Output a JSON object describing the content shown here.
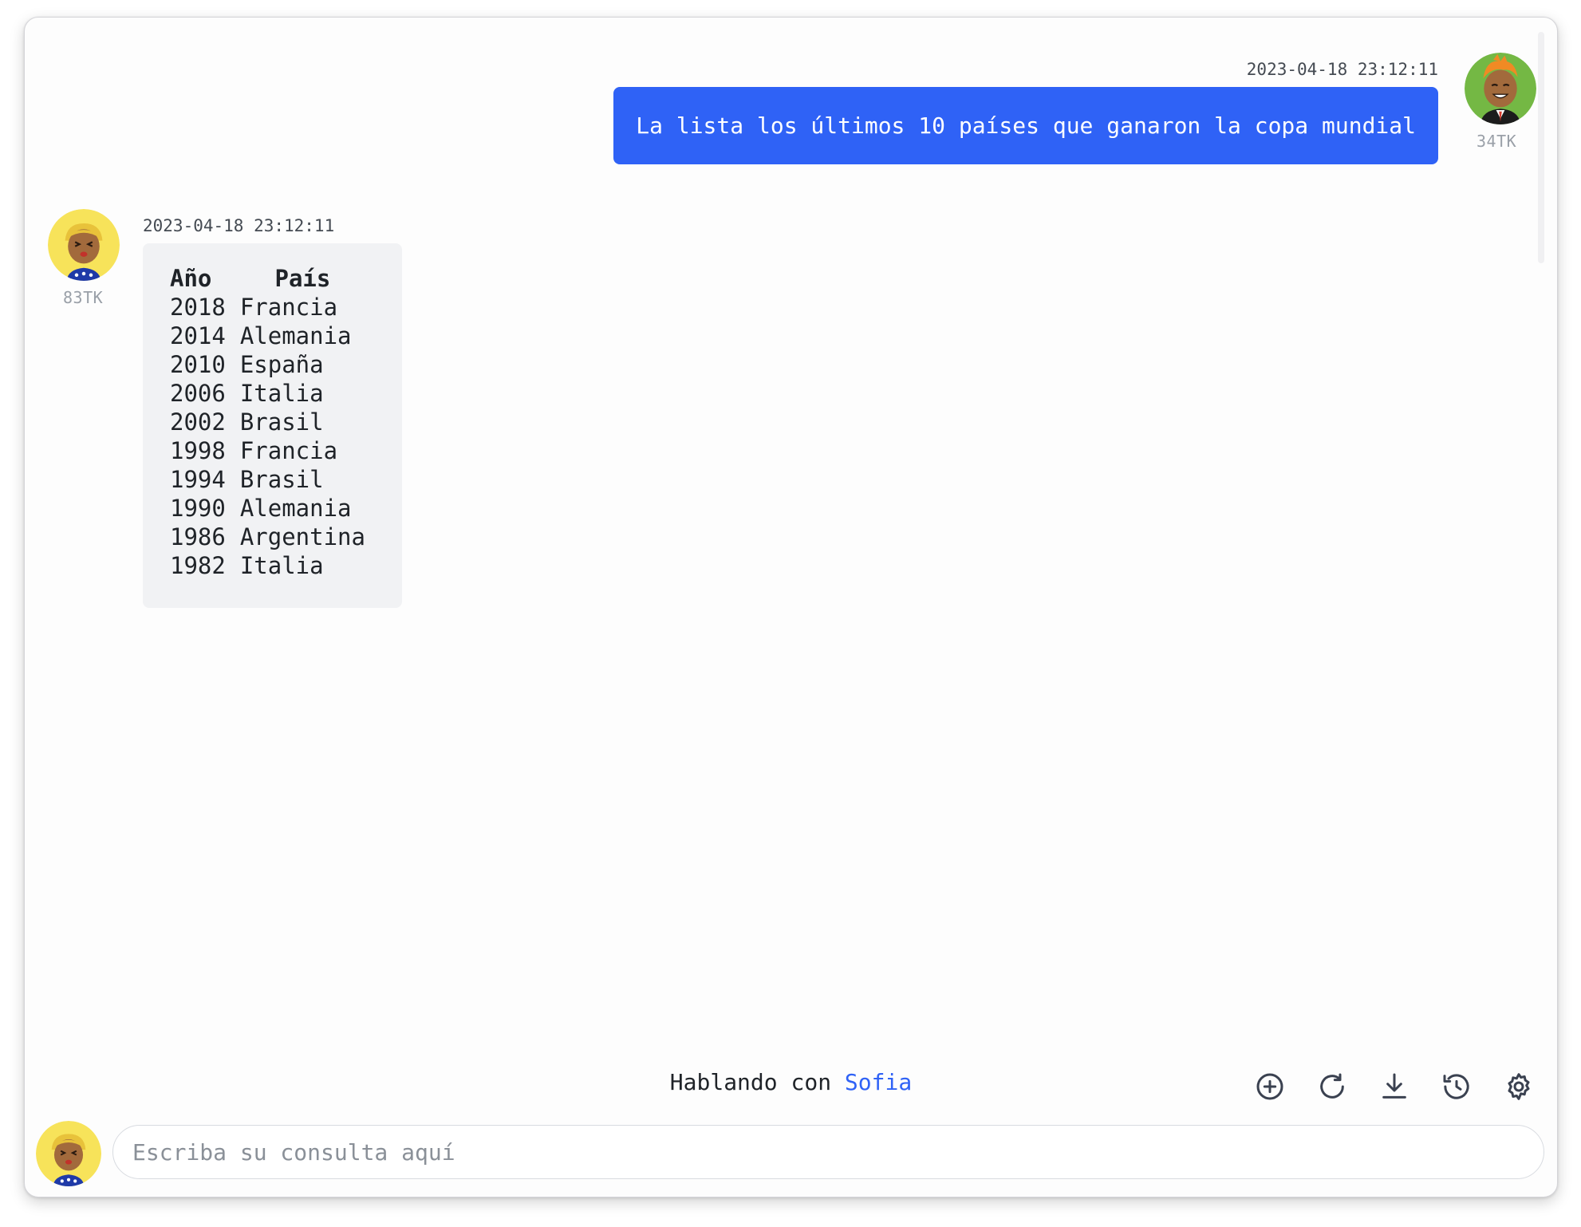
{
  "conversation": {
    "user_message": {
      "timestamp": "2023-04-18 23:12:11",
      "text": "La lista los últimos 10 países que ganaron la copa mundial",
      "tokens": "34TK"
    },
    "bot_message": {
      "timestamp": "2023-04-18 23:12:11",
      "tokens": "83TK",
      "table": {
        "headers": [
          "Año",
          "País"
        ],
        "rows": [
          [
            "2018",
            "Francia"
          ],
          [
            "2014",
            "Alemania"
          ],
          [
            "2010",
            "España"
          ],
          [
            "2006",
            "Italia"
          ],
          [
            "2002",
            "Brasil"
          ],
          [
            "1998",
            "Francia"
          ],
          [
            "1994",
            "Brasil"
          ],
          [
            "1990",
            "Alemania"
          ],
          [
            "1986",
            "Argentina"
          ],
          [
            "1982",
            "Italia"
          ]
        ]
      }
    }
  },
  "status": {
    "prefix": "Hablando con",
    "agent_name": "Sofia"
  },
  "toolbar": [
    "add-icon",
    "refresh-icon",
    "download-icon",
    "history-icon",
    "settings-icon"
  ],
  "input": {
    "placeholder": "Escriba su consulta aquí",
    "value": ""
  },
  "colors": {
    "accent": "#2f62f6",
    "bot_bubble": "#f1f2f4",
    "user_avatar_bg": "#74b844",
    "bot_avatar_bg": "#f7e35a"
  }
}
